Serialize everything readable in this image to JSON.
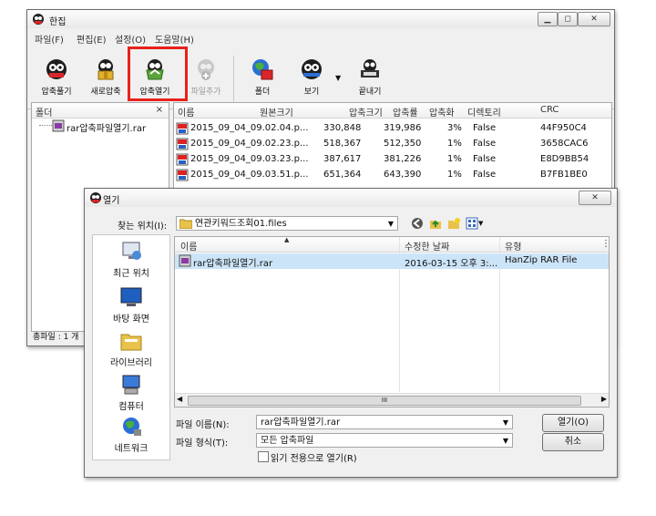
{
  "main_window": {
    "title": "한집",
    "menu": [
      "파일(F)",
      "편집(E)",
      "설정(O)",
      "도움말(H)"
    ],
    "toolbar": [
      {
        "label": "압축풀기",
        "icon": "extract-icon"
      },
      {
        "label": "새로압축",
        "icon": "new-archive-icon"
      },
      {
        "label": "압축열기",
        "icon": "open-archive-icon"
      },
      {
        "label": "파일추가",
        "icon": "add-file-icon"
      },
      {
        "label": "폴더",
        "icon": "folder-view-icon"
      },
      {
        "label": "보기",
        "icon": "view-icon"
      },
      {
        "label": "끝내기",
        "icon": "exit-icon"
      }
    ],
    "folder_pane": {
      "header": "폴더",
      "close": "×",
      "tree_item": "rar압축파일열기.rar"
    },
    "file_list": {
      "columns": [
        "이름",
        "원본크기",
        "압축크기",
        "압축률",
        "압축화",
        "디렉토리",
        "CRC"
      ],
      "rows": [
        {
          "name": "2015_09_04_09.02.04.p...",
          "original": "330,848",
          "compressed": "319,986",
          "ratio": "3%",
          "dir": "False",
          "crc": "44F950C4"
        },
        {
          "name": "2015_09_04_09.02.23.p...",
          "original": "518,367",
          "compressed": "512,350",
          "ratio": "1%",
          "dir": "False",
          "crc": "3658CAC6"
        },
        {
          "name": "2015_09_04_09.03.23.p...",
          "original": "387,617",
          "compressed": "381,226",
          "ratio": "1%",
          "dir": "False",
          "crc": "E8D9BB54"
        },
        {
          "name": "2015_09_04_09.03.51.p...",
          "original": "651,364",
          "compressed": "643,390",
          "ratio": "1%",
          "dir": "False",
          "crc": "B7FB1BE0"
        }
      ]
    },
    "status": "총파일 : 1 개"
  },
  "open_dialog": {
    "title": "열기",
    "look_in_label": "찾는 위치(I):",
    "look_in_value": "연관키워드조회01.files",
    "places": [
      "최근 위치",
      "바탕 화면",
      "라이브러리",
      "컴퓨터",
      "네트워크"
    ],
    "columns": [
      "이름",
      "수정한 날짜",
      "유형"
    ],
    "files": [
      {
        "name": "rar압축파일열기.rar",
        "modified": "2016-03-15 오후 3:...",
        "type": "HanZip RAR File"
      }
    ],
    "filename_label": "파일 이름(N):",
    "filename_value": "rar압축파일열기.rar",
    "filetype_label": "파일 형식(T):",
    "filetype_value": "모든 압축파일",
    "readonly_label": "읽기 전용으로 열기(R)",
    "open_button": "열기(O)",
    "cancel_button": "취소",
    "scroll_grip": "III"
  },
  "colors": {
    "highlight": "#e8211a",
    "selection": "#cce4f7"
  }
}
